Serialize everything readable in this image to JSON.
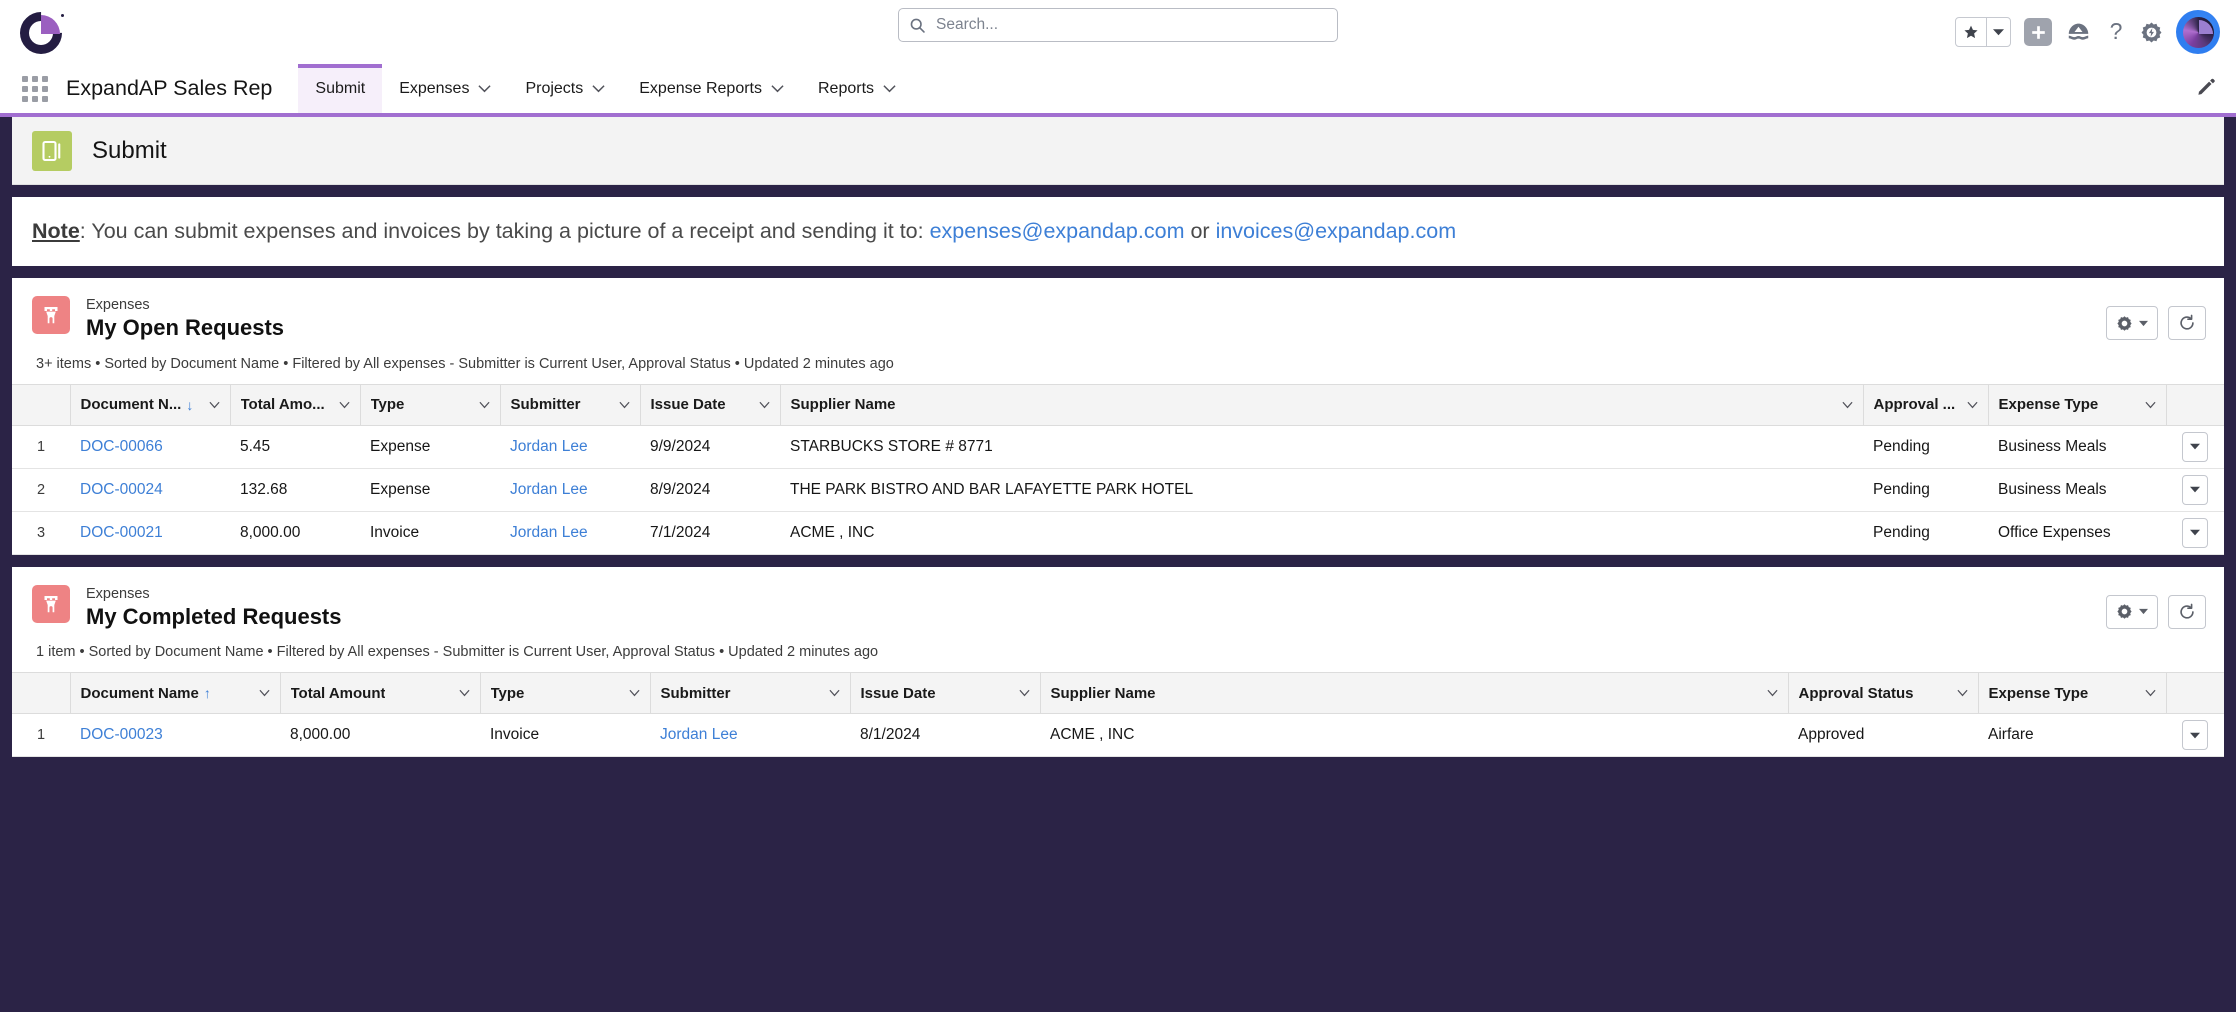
{
  "topbar": {
    "logo_name": "expandap-logo",
    "search": {
      "placeholder": "Search...",
      "value": ""
    },
    "favorites_label": "",
    "icons": [
      "favorites-star-icon",
      "favorites-dropdown-icon",
      "add-icon",
      "einstein-icon",
      "help-icon",
      "setup-gear-icon",
      "user-avatar"
    ]
  },
  "nav": {
    "app_launcher": "app-launcher",
    "app_name": "ExpandAP Sales Rep",
    "tabs": [
      {
        "label": "Submit",
        "has_menu": false,
        "active": true
      },
      {
        "label": "Expenses",
        "has_menu": true,
        "active": false
      },
      {
        "label": "Projects",
        "has_menu": true,
        "active": false
      },
      {
        "label": "Expense Reports",
        "has_menu": true,
        "active": false
      },
      {
        "label": "Reports",
        "has_menu": true,
        "active": false
      }
    ],
    "edit_label": "Edit Page"
  },
  "page_header": {
    "title": "Submit",
    "icon": "mobile-device-icon"
  },
  "note": {
    "label": "Note",
    "text_before": ": You can submit expenses and invoices by taking a picture of a receipt and sending it to: ",
    "email1": "expenses@expandap.com",
    "conjunction": " or ",
    "email2": "invoices@expandap.com"
  },
  "open_requests": {
    "object_label": "Expenses",
    "list_name": "My Open Requests",
    "meta": "3+ items • Sorted by Document Name • Filtered by All expenses - Submitter is Current User, Approval Status • Updated 2 minutes ago",
    "gear_label": "List View Controls",
    "refresh_label": "Refresh",
    "sort_direction": "desc",
    "columns": [
      "Document N...",
      "Total Amo...",
      "Type",
      "Submitter",
      "Issue Date",
      "Supplier Name",
      "Approval ...",
      "Expense Type"
    ],
    "rows": [
      {
        "index": "1",
        "document_name": "DOC-00066",
        "total_amount": "5.45",
        "type": "Expense",
        "submitter": "Jordan Lee",
        "issue_date": "9/9/2024",
        "supplier_name": "STARBUCKS STORE # 8771",
        "approval_status": "Pending",
        "expense_type": "Business Meals"
      },
      {
        "index": "2",
        "document_name": "DOC-00024",
        "total_amount": "132.68",
        "type": "Expense",
        "submitter": "Jordan Lee",
        "issue_date": "8/9/2024",
        "supplier_name": "THE PARK BISTRO AND BAR LAFAYETTE PARK HOTEL",
        "approval_status": "Pending",
        "expense_type": "Business Meals"
      },
      {
        "index": "3",
        "document_name": "DOC-00021",
        "total_amount": "8,000.00",
        "type": "Invoice",
        "submitter": "Jordan Lee",
        "issue_date": "7/1/2024",
        "supplier_name": "ACME , INC",
        "approval_status": "Pending",
        "expense_type": "Office Expenses"
      }
    ]
  },
  "completed_requests": {
    "object_label": "Expenses",
    "list_name": "My Completed Requests",
    "meta": "1 item • Sorted by Document Name • Filtered by All expenses - Submitter is Current User, Approval Status • Updated 2 minutes ago",
    "gear_label": "List View Controls",
    "refresh_label": "Refresh",
    "sort_direction": "asc",
    "columns": [
      "Document Name",
      "Total Amount",
      "Type",
      "Submitter",
      "Issue Date",
      "Supplier Name",
      "Approval Status",
      "Expense Type"
    ],
    "rows": [
      {
        "index": "1",
        "document_name": "DOC-00023",
        "total_amount": "8,000.00",
        "type": "Invoice",
        "submitter": "Jordan Lee",
        "issue_date": "8/1/2024",
        "supplier_name": "ACME , INC",
        "approval_status": "Approved",
        "expense_type": "Airfare"
      }
    ]
  },
  "colors": {
    "brand_purple": "#a16ed0",
    "dark_navy": "#2b2346",
    "link_blue": "#3d7fd6",
    "submit_green": "#b5cc62",
    "list_icon_salmon": "#ee8384"
  }
}
